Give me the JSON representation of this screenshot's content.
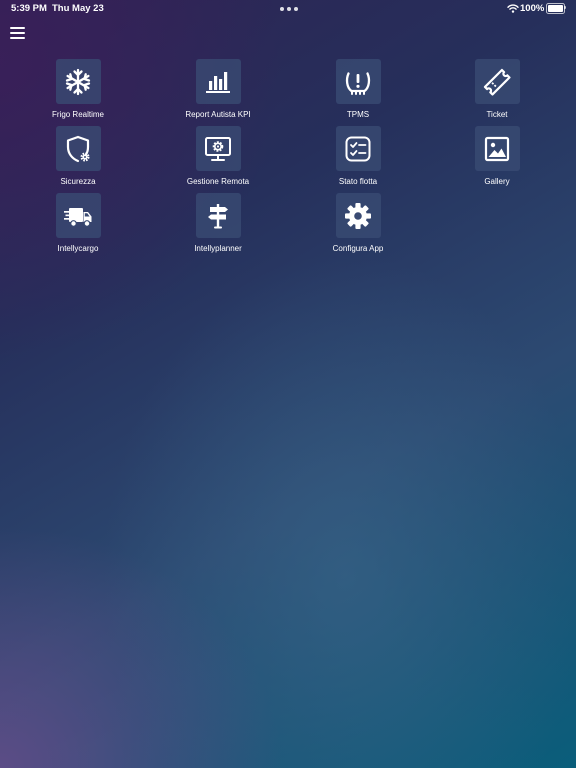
{
  "status_bar": {
    "time": "5:39 PM",
    "date": "Thu May 23",
    "battery_percent": "100%",
    "battery_level": 1.0,
    "wifi_icon": "wifi-icon",
    "battery_icon": "battery-icon"
  },
  "menu": {
    "icon": "hamburger-menu-icon"
  },
  "apps": [
    {
      "label": "Frigo Realtime",
      "icon": "snowflake-icon"
    },
    {
      "label": "Report Autista KPI",
      "icon": "bar-chart-icon"
    },
    {
      "label": "TPMS",
      "icon": "tire-pressure-icon"
    },
    {
      "label": "Ticket",
      "icon": "ticket-icon"
    },
    {
      "label": "Sicurezza",
      "icon": "shield-gear-icon"
    },
    {
      "label": "Gestione Remota",
      "icon": "monitor-gear-icon"
    },
    {
      "label": "Stato flotta",
      "icon": "checklist-icon"
    },
    {
      "label": "Gallery",
      "icon": "image-icon"
    },
    {
      "label": "Intellycargo",
      "icon": "truck-icon"
    },
    {
      "label": "Intellyplanner",
      "icon": "signpost-icon"
    },
    {
      "label": "Configura App",
      "icon": "gear-icon"
    }
  ],
  "colors": {
    "tile_background": "#3a4b73",
    "text": "#ffffff",
    "background_top": "#2e2353",
    "background_bottom": "#0a5e7b"
  }
}
